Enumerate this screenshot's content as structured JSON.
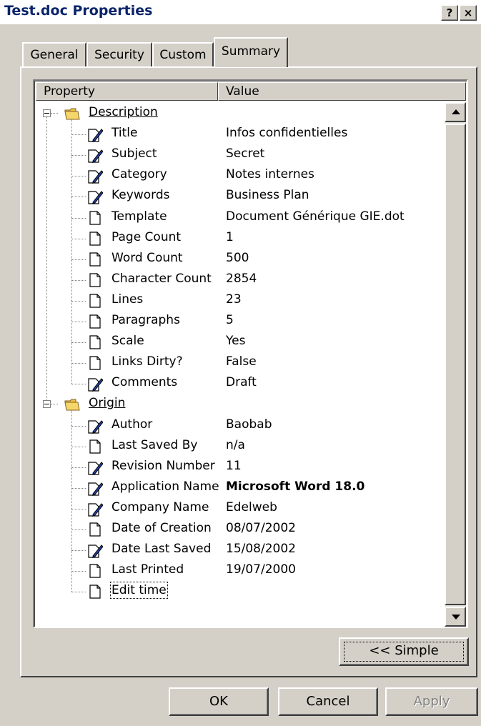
{
  "window": {
    "title": "Test.doc Properties",
    "help_label": "?",
    "close_label": "×"
  },
  "tabs": [
    {
      "label": "General"
    },
    {
      "label": "Security"
    },
    {
      "label": "Custom"
    },
    {
      "label": "Summary",
      "active": true
    }
  ],
  "columns": {
    "property": "Property",
    "value": "Value"
  },
  "groups": {
    "description": {
      "label": "Description",
      "items": [
        {
          "label": "Title",
          "value": "Infos confidentielles",
          "icon": "editable-doc-icon"
        },
        {
          "label": "Subject",
          "value": "Secret",
          "icon": "editable-doc-icon"
        },
        {
          "label": "Category",
          "value": "Notes internes",
          "icon": "editable-doc-icon"
        },
        {
          "label": "Keywords",
          "value": "Business Plan",
          "icon": "editable-doc-icon"
        },
        {
          "label": "Template",
          "value": "Document Générique GIE.dot",
          "icon": "doc-icon"
        },
        {
          "label": "Page Count",
          "value": "1",
          "icon": "doc-icon"
        },
        {
          "label": "Word Count",
          "value": "500",
          "icon": "doc-icon"
        },
        {
          "label": "Character Count",
          "value": "2854",
          "icon": "doc-icon"
        },
        {
          "label": "Lines",
          "value": "23",
          "icon": "doc-icon"
        },
        {
          "label": "Paragraphs",
          "value": "5",
          "icon": "doc-icon"
        },
        {
          "label": "Scale",
          "value": "Yes",
          "icon": "doc-icon"
        },
        {
          "label": "Links Dirty?",
          "value": "False",
          "icon": "doc-icon"
        },
        {
          "label": "Comments",
          "value": "Draft",
          "icon": "editable-doc-icon"
        }
      ]
    },
    "origin": {
      "label": "Origin",
      "items": [
        {
          "label": "Author",
          "value": "Baobab",
          "icon": "editable-doc-icon"
        },
        {
          "label": "Last Saved By",
          "value": "n/a",
          "icon": "doc-icon"
        },
        {
          "label": "Revision Number",
          "value": "11",
          "icon": "editable-doc-icon"
        },
        {
          "label": "Application Name",
          "value": "Microsoft Word 18.0",
          "icon": "editable-doc-icon",
          "bold": true
        },
        {
          "label": "Company Name",
          "value": "Edelweb",
          "icon": "editable-doc-icon"
        },
        {
          "label": "Date of Creation",
          "value": "08/07/2002",
          "icon": "doc-icon"
        },
        {
          "label": "Date Last Saved",
          "value": "15/08/2002",
          "icon": "editable-doc-icon"
        },
        {
          "label": "Last Printed",
          "value": "19/07/2000",
          "icon": "doc-icon"
        },
        {
          "label": "Edit time",
          "value": "",
          "icon": "doc-icon",
          "focused": true
        }
      ]
    }
  },
  "buttons": {
    "simple": "<< Simple",
    "ok": "OK",
    "cancel": "Cancel",
    "apply": "Apply"
  },
  "colors": {
    "dialog_bg": "#d4d0c8",
    "title_text": "#0a246a",
    "folder": "#f5d66b"
  }
}
